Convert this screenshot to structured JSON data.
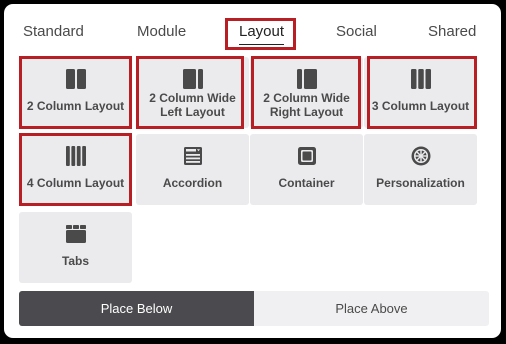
{
  "tabs": [
    {
      "label": "Standard"
    },
    {
      "label": "Module"
    },
    {
      "label": "Layout"
    },
    {
      "label": "Social"
    },
    {
      "label": "Shared"
    }
  ],
  "active_tab": "Layout",
  "tiles": [
    {
      "line1": "2 Column Layout",
      "line2": "",
      "icon": "two-column-icon"
    },
    {
      "line1": "2 Column Wide",
      "line2": "Left Layout",
      "icon": "two-column-wide-left-icon"
    },
    {
      "line1": "2 Column Wide",
      "line2": "Right Layout",
      "icon": "two-column-wide-right-icon"
    },
    {
      "line1": "3 Column Layout",
      "line2": "",
      "icon": "three-column-icon"
    },
    {
      "line1": "4 Column Layout",
      "line2": "",
      "icon": "four-column-icon"
    },
    {
      "line1": "Accordion",
      "line2": "",
      "icon": "accordion-icon"
    },
    {
      "line1": "Container",
      "line2": "",
      "icon": "container-icon"
    },
    {
      "line1": "Personalization",
      "line2": "",
      "icon": "personalization-icon"
    },
    {
      "line1": "Tabs",
      "line2": "",
      "icon": "tabs-icon"
    }
  ],
  "placement": {
    "below_label": "Place Below",
    "above_label": "Place Above",
    "selected": "Place Below"
  },
  "colors": {
    "highlight": "#b81f25",
    "tile_bg": "#ebebee",
    "icon": "#4a4a4a",
    "selected_toggle": "#4b4b4f"
  }
}
